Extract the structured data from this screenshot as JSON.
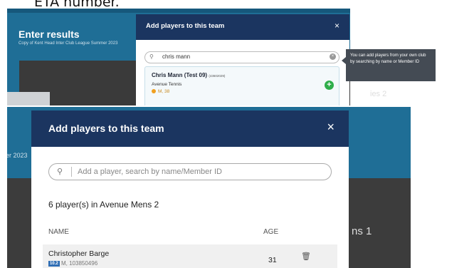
{
  "top_caption": "ETA number.",
  "upper": {
    "page_title": "Enter results",
    "page_subtitle": "Copy of Kent Head Inter Club League Summer 2023",
    "modal_title": "Add players to this team",
    "close_glyph": "×",
    "search_value": "chris mann",
    "result": {
      "name": "Chris Mann (Test 09)",
      "member_id": "(43602029)",
      "club": "Avenue Tennis",
      "meta": "M, 38"
    },
    "tooltip": "You can add players from your own club by searching by name or Member ID",
    "peek_text": "ies 2"
  },
  "lower": {
    "peek_left": "er 2023",
    "peek_right": "ns 1",
    "modal_title": "Add players to this team",
    "close_glyph": "×",
    "search_placeholder": "Add a player, search by name/Member ID",
    "count_text": "6 player(s) in Avenue Mens 2",
    "columns": {
      "name": "NAME",
      "age": "AGE"
    },
    "row": {
      "name": "Christopher Barge",
      "badge": "10.2",
      "member": "M, 103850496",
      "age": "31"
    }
  },
  "colors": {
    "brand_navy": "#1b3560",
    "page_blue": "#1f6e96",
    "add_green": "#2fae4a",
    "tooltip_bg": "#444b54"
  },
  "icons": [
    "search-icon",
    "close-icon",
    "clear-icon",
    "add-icon",
    "trash-icon"
  ]
}
